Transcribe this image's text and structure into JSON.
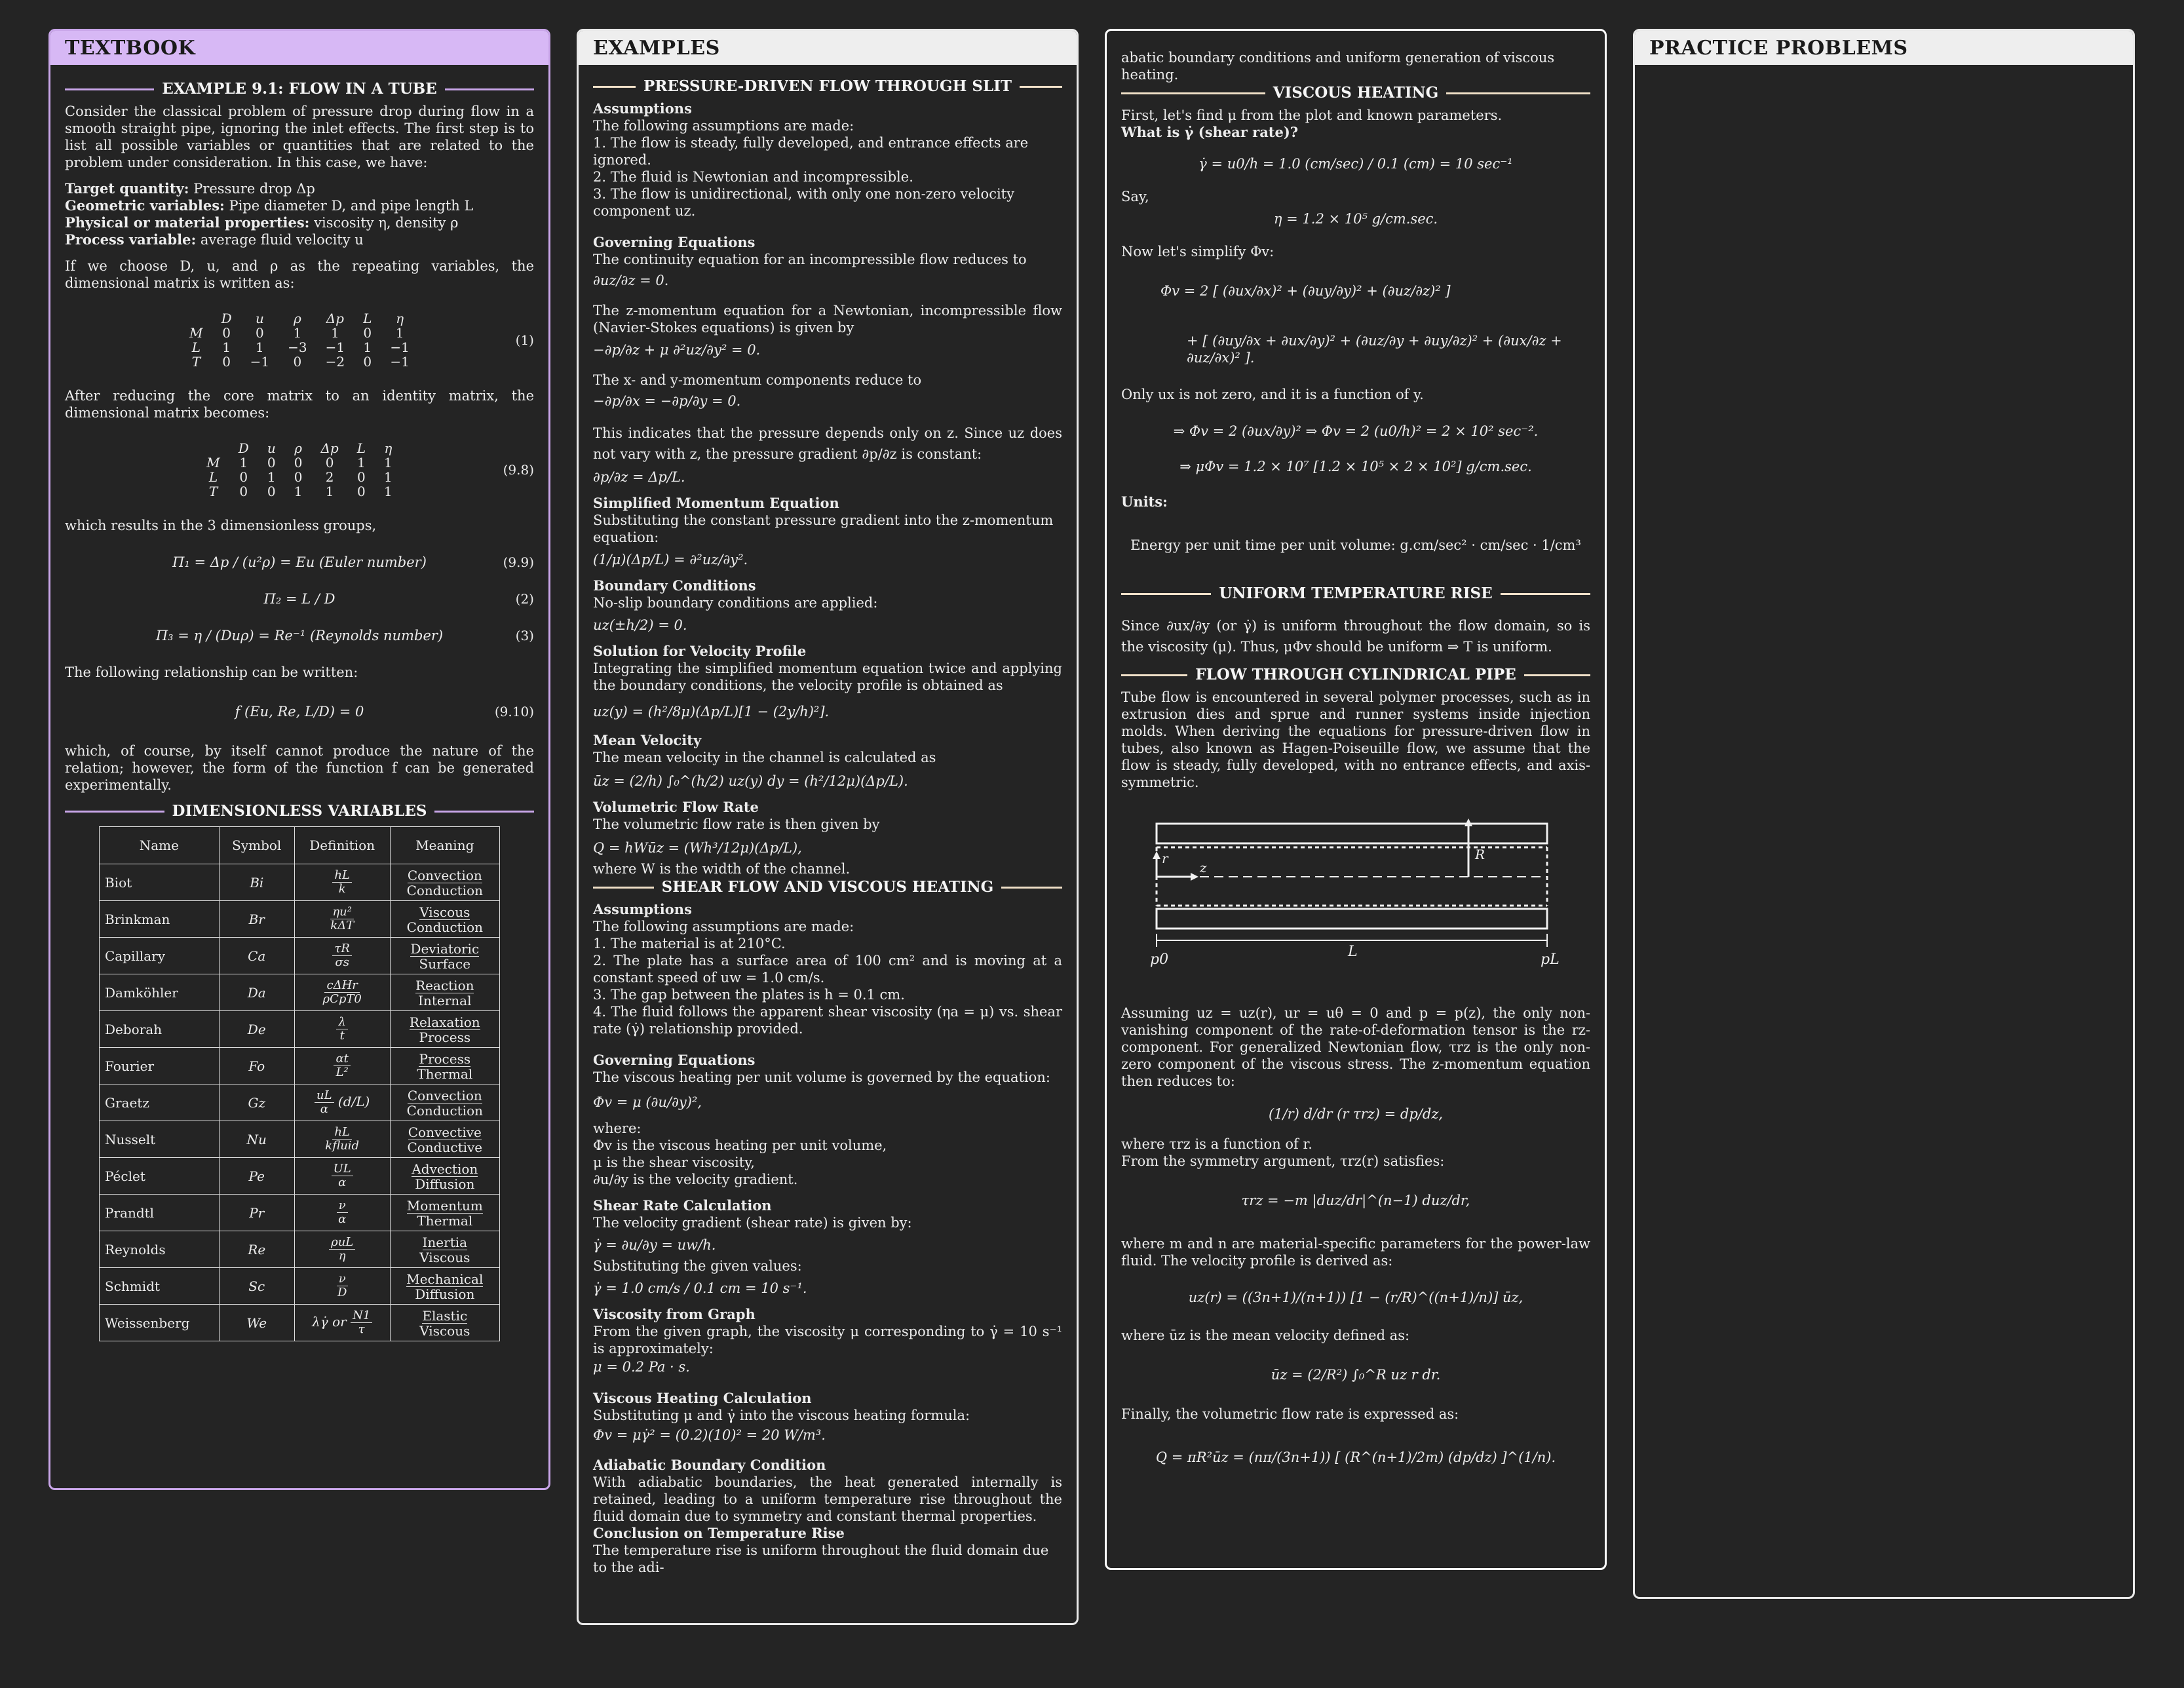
{
  "panels": {
    "textbook": "TEXTBOOK",
    "examples": "EXAMPLES",
    "practice": "PRACTICE PROBLEMS"
  },
  "textbook": {
    "ex_title": "EXAMPLE 9.1: FLOW IN A TUBE",
    "intro": "Consider the classical problem of pressure drop during flow in a smooth straight pipe, ignoring the inlet effects. The first step is to list all possible variables or quantities that are related to the problem under consideration. In this case, we have:",
    "target_label": "Target quantity:",
    "target_val": " Pressure drop Δp",
    "geo_label": "Geometric variables:",
    "geo_val": " Pipe diameter D, and pipe length L",
    "phys_label": "Physical or material properties:",
    "phys_val": " viscosity η, density ρ",
    "proc_label": "Process variable:",
    "proc_val": " average fluid velocity u",
    "repeat_text": "If we choose D, u, and ρ as the repeating variables, the dimensional matrix is written as:",
    "matrix1": {
      "head": [
        "",
        "D",
        "u",
        "ρ",
        "Δp",
        "L",
        "η"
      ],
      "rows": [
        [
          "M",
          "0",
          "0",
          "1",
          "1",
          "0",
          "1"
        ],
        [
          "L",
          "1",
          "1",
          "−3",
          "−1",
          "1",
          "−1"
        ],
        [
          "T",
          "0",
          "−1",
          "0",
          "−2",
          "0",
          "−1"
        ]
      ],
      "num": "(1)"
    },
    "reduce_text": "After reducing the core matrix to an identity matrix, the dimensional matrix becomes:",
    "matrix2": {
      "head": [
        "",
        "D",
        "u",
        "ρ",
        "Δp",
        "L",
        "η"
      ],
      "rows": [
        [
          "M",
          "1",
          "0",
          "0",
          "0",
          "1",
          "1"
        ],
        [
          "L",
          "0",
          "1",
          "0",
          "2",
          "0",
          "1"
        ],
        [
          "T",
          "0",
          "0",
          "1",
          "1",
          "0",
          "1"
        ]
      ],
      "num": "(9.8)"
    },
    "groups_text": "which results in the 3 dimensionless groups,",
    "pi1": "Π₁ = Δp / (u²ρ) = Eu (Euler number)",
    "pi1_num": "(9.9)",
    "pi2": "Π₂ = L / D",
    "pi2_num": "(2)",
    "pi3": "Π₃ = η / (Duρ) = Re⁻¹ (Reynolds number)",
    "pi3_num": "(3)",
    "rel_text": "The following relationship can be written:",
    "rel_eq": "f (Eu, Re, L/D) = 0",
    "rel_num": "(9.10)",
    "closing": "which, of course, by itself cannot produce the nature of the relation; however, the form of the function f can be generated experimentally.",
    "dv_title": "DIMENSIONLESS VARIABLES",
    "dv_headers": [
      "Name",
      "Symbol",
      "Definition",
      "Meaning"
    ],
    "dv_rows": [
      {
        "name": "Biot",
        "sym": "Bi",
        "def_n": "hL",
        "def_d": "k",
        "m_n": "Convection",
        "m_d": "Conduction"
      },
      {
        "name": "Brinkman",
        "sym": "Br",
        "def_n": "ηu²",
        "def_d": "kΔT",
        "m_n": "Viscous",
        "m_d": "Conduction"
      },
      {
        "name": "Capillary",
        "sym": "Ca",
        "def_n": "τR",
        "def_d": "σs",
        "m_n": "Deviatoric",
        "m_d": "Surface"
      },
      {
        "name": "Damköhler",
        "sym": "Da",
        "def_n": "cΔHr",
        "def_d": "ρCpT0",
        "m_n": "Reaction",
        "m_d": "Internal"
      },
      {
        "name": "Deborah",
        "sym": "De",
        "def_n": "λ",
        "def_d": "t",
        "m_n": "Relaxation",
        "m_d": "Process"
      },
      {
        "name": "Fourier",
        "sym": "Fo",
        "def_n": "αt",
        "def_d": "L²",
        "m_n": "Process",
        "m_d": "Thermal"
      },
      {
        "name": "Graetz",
        "sym": "Gz",
        "def_n": "uL",
        "def_d": "α",
        "def_x": "(d/L)",
        "m_n": "Convection",
        "m_d": "Conduction"
      },
      {
        "name": "Nusselt",
        "sym": "Nu",
        "def_n": "hL",
        "def_d": "kfluid",
        "m_n": "Convective",
        "m_d": "Conductive"
      },
      {
        "name": "Péclet",
        "sym": "Pe",
        "def_n": "UL",
        "def_d": "α",
        "m_n": "Advection",
        "m_d": "Diffusion"
      },
      {
        "name": "Prandtl",
        "sym": "Pr",
        "def_n": "ν",
        "def_d": "α",
        "m_n": "Momentum",
        "m_d": "Thermal"
      },
      {
        "name": "Reynolds",
        "sym": "Re",
        "def_n": "ρuL",
        "def_d": "η",
        "m_n": "Inertia",
        "m_d": "Viscous"
      },
      {
        "name": "Schmidt",
        "sym": "Sc",
        "def_n": "ν",
        "def_d": "D",
        "m_n": "Mechanical",
        "m_d": "Diffusion"
      },
      {
        "name": "Weissenberg",
        "sym": "We",
        "def_pre": "λγ̇ or",
        "def_n": "N1",
        "def_d": "τ",
        "m_n": "Elastic",
        "m_d": "Viscous"
      }
    ]
  },
  "examples": {
    "slit_title": "PRESSURE-DRIVEN FLOW THROUGH SLIT",
    "assump_h": "Assumptions",
    "assump_intro": "The following assumptions are made:",
    "assump_1": "1. The flow is steady, fully developed, and entrance effects are ignored.",
    "assump_2": "2. The fluid is Newtonian and incompressible.",
    "assump_3": "3. The flow is unidirectional, with only one non-zero velocity component uz.",
    "gov_h": "Governing Equations",
    "gov_text": "The continuity equation for an incompressible flow reduces to",
    "gov_eq": "∂uz/∂z = 0.",
    "zmom_text": "The z-momentum equation for a Newtonian, incompressible flow (Navier-Stokes equations) is given by",
    "zmom_eq": "−∂p/∂z + μ ∂²uz/∂y² = 0.",
    "xy_text": "The x- and y-momentum components reduce to",
    "xy_eq": "−∂p/∂x = −∂p/∂y = 0.",
    "press_text": "This indicates that the pressure depends only on z. Since uz does not vary with z, the pressure gradient ∂p/∂z is constant:",
    "press_eq": "∂p/∂z = Δp/L.",
    "simp_h": "Simplified Momentum Equation",
    "simp_text": "Substituting the constant pressure gradient into the z-momentum equation:",
    "simp_eq": "(1/μ)(Δp/L) = ∂²uz/∂y².",
    "bc_h": "Boundary Conditions",
    "bc_text": "No-slip boundary conditions are applied:",
    "bc_eq": "uz(±h/2) = 0.",
    "sol_h": "Solution for Velocity Profile",
    "sol_text": "Integrating the simplified momentum equation twice and applying the boundary conditions, the velocity profile is obtained as",
    "sol_eq": "uz(y) = (h²/8μ)(Δp/L)[1 − (2y/h)²].",
    "mean_h": "Mean Velocity",
    "mean_text": "The mean velocity in the channel is calculated as",
    "mean_eq": "ūz = (2/h) ∫₀^(h/2) uz(y) dy = (h²/12μ)(Δp/L).",
    "vfr_h": "Volumetric Flow Rate",
    "vfr_text": "The volumetric flow rate is then given by",
    "vfr_eq": "Q = hWūz = (Wh³/12μ)(Δp/L),",
    "vfr_where": "where W is the width of the channel.",
    "shear_title": "SHEAR FLOW AND VISCOUS HEATING",
    "s_assump_h": "Assumptions",
    "s_assump_intro": "The following assumptions are made:",
    "s_assump_1": "1. The material is at 210°C.",
    "s_assump_2": "2. The plate has a surface area of 100 cm² and is moving at a constant speed of uw = 1.0 cm/s.",
    "s_assump_3": "3. The gap between the plates is h = 0.1 cm.",
    "s_assump_4": "4. The fluid follows the apparent shear viscosity (ηa = μ) vs. shear rate (γ̇) relationship provided.",
    "s_gov_h": "Governing Equations",
    "s_gov_text": "The viscous heating per unit volume is governed by the equation:",
    "s_gov_eq": "Φv = μ (∂u/∂y)²,",
    "s_where": "where:",
    "s_where_1": "Φv is the viscous heating per unit volume,",
    "s_where_2": "μ is the shear viscosity,",
    "s_where_3": "∂u/∂y is the velocity gradient.",
    "src_h": "Shear Rate Calculation",
    "src_text": "The velocity gradient (shear rate) is given by:",
    "src_eq": "γ̇ = ∂u/∂y = uw/h.",
    "src_sub": "Substituting the given values:",
    "src_eq2": "γ̇ = 1.0 cm/s / 0.1 cm = 10 s⁻¹.",
    "vg_h": "Viscosity from Graph",
    "vg_text": "From the given graph, the viscosity μ corresponding to γ̇ = 10 s⁻¹ is approximately:",
    "vg_eq": "μ = 0.2 Pa · s.",
    "vhc_h": "Viscous Heating Calculation",
    "vhc_text": "Substituting μ and γ̇ into the viscous heating formula:",
    "vhc_eq": "Φv = μγ̇² = (0.2)(10)² = 20 W/m³.",
    "abc_h": "Adiabatic Boundary Condition",
    "abc_text": "With adiabatic boundaries, the heat generated internally is retained, leading to a uniform temperature rise throughout the fluid domain due to symmetry and constant thermal properties.",
    "ctr_h": "Conclusion on Temperature Rise",
    "ctr_text": "The temperature rise is uniform throughout the fluid domain due to the adi-"
  },
  "continued": {
    "top_text": "abatic boundary conditions and uniform generation of viscous heating.",
    "vh_title": "VISCOUS HEATING",
    "vh_text1": "First, let's find μ from the plot and known parameters.",
    "vh_q": "What is γ̇ (shear rate)?",
    "vh_eq1": "γ̇ = u0/h = 1.0 (cm/sec) / 0.1 (cm) = 10 sec⁻¹",
    "say": "Say,",
    "vh_eq2": "η = 1.2 × 10⁵ g/cm.sec.",
    "simplify": "Now let's simplify Φv:",
    "phi_eq1": "Φv = 2 [ (∂ux/∂x)² + (∂uy/∂y)² + (∂uz/∂z)² ]",
    "phi_eq2": "+ [ (∂uy/∂x + ∂ux/∂y)² + (∂uz/∂y + ∂uy/∂z)² + (∂ux/∂z + ∂uz/∂x)² ].",
    "only_text": "Only ux is not zero, and it is a function of y.",
    "phi_eq3": "⇒ Φv = 2 (∂ux/∂y)²   ⇒   Φv = 2 (u0/h)² = 2 × 10² sec⁻².",
    "phi_eq4": "⇒ μΦv = 1.2 × 10⁷ [1.2 × 10⁵ × 2 × 10²] g/cm.sec.",
    "units_h": "Units:",
    "units_eq": "Energy per unit time per unit volume:   g.cm/sec² · cm/sec · 1/cm³",
    "utr_title": "UNIFORM TEMPERATURE RISE",
    "utr_text1": "Since ∂ux/∂y (or γ̇) is uniform throughout the flow domain, so is the viscosity (μ). Thus, μΦv should be uniform ⇒ T is uniform.",
    "fcp_title": "FLOW THROUGH CYLINDRICAL PIPE",
    "fcp_text": "Tube flow is encountered in several polymer processes, such as in extrusion dies and sprue and runner systems inside injection molds. When deriving the equations for pressure-driven flow in tubes, also known as Hagen-Poiseuille flow, we assume that the flow is steady, fully developed, with no entrance effects, and axis-symmetric.",
    "diag_r": "r",
    "diag_z": "z",
    "diag_R": "R",
    "diag_p0": "p0",
    "diag_L": "L",
    "diag_pL": "pL",
    "assume_text": "Assuming uz = uz(r), ur = uθ = 0 and p = p(z), the only non-vanishing component of the rate-of-deformation tensor is the rz-component. For generalized Newtonian flow, τrz is the only non-zero component of the viscous stress. The z-momentum equation then reduces to:",
    "zm_eq": "(1/r) d/dr (r τrz) = dp/dz,",
    "where_tau": "where τrz is a function of r.",
    "sym_text": "From the symmetry argument, τrz(r) satisfies:",
    "tau_eq": "τrz = −m |duz/dr|^(n−1) duz/dr,",
    "mn_text": "where m and n are material-specific parameters for the power-law fluid. The velocity profile is derived as:",
    "vel_eq": "uz(r) = ((3n+1)/(n+1)) [1 − (r/R)^((n+1)/n)] ūz,",
    "mean_text": "where ūz is the mean velocity defined as:",
    "mean_eq": "ūz = (2/R²) ∫₀^R uz r dr.",
    "final_text": "Finally, the volumetric flow rate is expressed as:",
    "final_eq": "Q = πR²ūz = (nπ/(3n+1)) [ (R^(n+1)/2m) (dp/dz) ]^(1/n)."
  }
}
